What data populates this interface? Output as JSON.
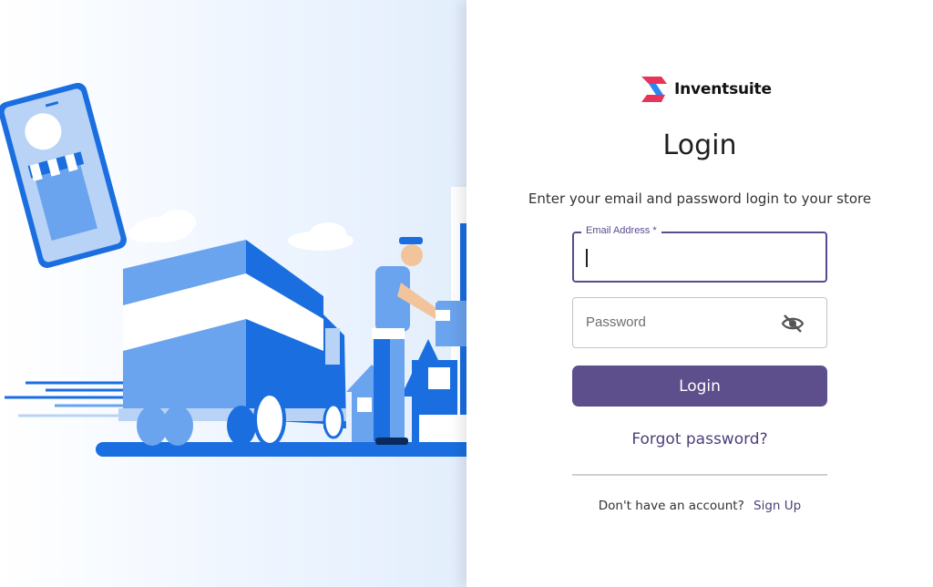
{
  "brand": {
    "name": "Inventsuite",
    "logo_icon": "inventsuite-logo-icon"
  },
  "login": {
    "title": "Login",
    "subtitle": "Enter your email and password login to your store",
    "email": {
      "label": "Email Address *",
      "value": "",
      "placeholder": ""
    },
    "password": {
      "placeholder": "Password",
      "value": "",
      "toggle_icon": "eye-off-icon"
    },
    "submit_label": "Login",
    "forgot_label": "Forgot password?",
    "signup_prompt": "Don't have an account?",
    "signup_label": "Sign Up"
  },
  "illustration": {
    "subject": "delivery-truck-scene"
  },
  "colors": {
    "primary": "#5d4e8c",
    "primary_border": "#5b4a8f",
    "link": "#4d3f77",
    "illustration_blue": "#1a6ee0",
    "illustration_light_blue": "#6aa3ee",
    "logo_red": "#e8345a",
    "logo_blue": "#2d87f0"
  }
}
